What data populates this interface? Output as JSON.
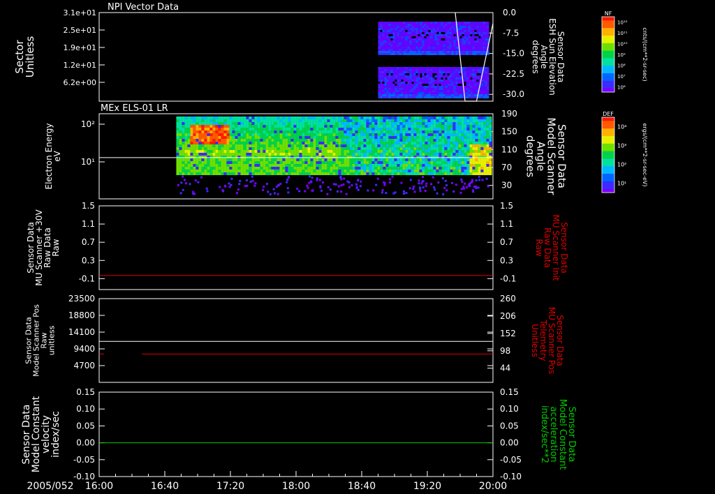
{
  "chart_data": [
    {
      "type": "heatmap",
      "title": "NPI Vector Data",
      "ylabel": [
        "Sector",
        "Unitless"
      ],
      "yticks": [
        "3.1e+01",
        "2.5e+01",
        "1.9e+01",
        "1.2e+01",
        "6.2e+00"
      ],
      "right_label": [
        "Sensor Data",
        "ESH Sun Elevation",
        "Angle",
        "degrees"
      ],
      "right_ticks": [
        "0.0",
        "-7.5",
        "-15.0",
        "-22.5",
        "-30.0"
      ],
      "right_range": [
        -32.5,
        0
      ],
      "colorbar": {
        "title": "NF",
        "unit": "cnts/(cm**2-sr-sec)",
        "ticks": [
          "10¹²",
          "10¹¹",
          "10¹⁰",
          "10⁹",
          "10⁸",
          "10⁷",
          "10⁶"
        ]
      },
      "data_start": "18:50",
      "overlay_line": {
        "times": [
          "19:37",
          "19:43",
          "19:50",
          "20:00"
        ],
        "values": [
          0,
          -32.5,
          -32.5,
          -4
        ]
      }
    },
    {
      "type": "heatmap",
      "title": "MEx ELS-01 LR",
      "ylabel": [
        "Electron Energy",
        "eV"
      ],
      "yticks": [
        "10²",
        "10¹"
      ],
      "right_label": [
        "Sensor Data",
        "Model Scanner",
        "Angle",
        "degrees"
      ],
      "right_ticks": [
        "190",
        "150",
        "110",
        "70",
        "30"
      ],
      "right_range": [
        0,
        190
      ],
      "colorbar": {
        "title": "DEF",
        "unit": "ergs/(cm**2-sr-sec-eV)",
        "ticks": [
          "10⁴",
          "10³",
          "10²",
          "10¹"
        ]
      },
      "data_start": "16:47",
      "overlay_value": 92
    },
    {
      "type": "line",
      "ylabel": [
        "Sensor Data",
        "MU Scanner +30V",
        "Raw Data",
        "Raw"
      ],
      "yticks": [
        "1.5",
        "1.1",
        "0.7",
        "0.3",
        "-0.1"
      ],
      "right_label": [
        "Sensor Data",
        "MU Scanner Init",
        "Raw Data",
        "Raw"
      ],
      "ylim": [
        -0.34,
        1.5
      ],
      "series": [
        {
          "color": "#e00000",
          "values": [
            -0.03
          ]
        }
      ]
    },
    {
      "type": "line",
      "ylabel": [
        "Sensor Data",
        "Model Scanner Pos",
        "Raw",
        "unitless"
      ],
      "yticks": [
        "23500",
        "18800",
        "14100",
        "9400",
        "4700"
      ],
      "right_label": [
        "Sensor Data",
        "MU Scanner Pos",
        "Telemetry",
        "Unitless"
      ],
      "right_ticks": [
        "260",
        "206",
        "152",
        "98",
        "44"
      ],
      "ylim": [
        0,
        23500
      ],
      "right_ylim": [
        0,
        260
      ],
      "series": [
        {
          "color": "#ffffff",
          "values": [
            11500
          ]
        },
        {
          "color": "#e00000",
          "segments": [
            [
              "16:00",
              "16:03"
            ],
            [
              "16:26",
              "20:00"
            ]
          ],
          "right_value": 88
        }
      ]
    },
    {
      "type": "line",
      "ylabel": [
        "Sensor Data",
        "Model Constant",
        "velocity",
        "index/sec"
      ],
      "yticks": [
        "0.15",
        "0.10",
        "0.05",
        "0.00",
        "-0.05",
        "-0.10"
      ],
      "right_label": [
        "Sensor Data",
        "Model Constant",
        "acceleration",
        "index/sec**2"
      ],
      "right_ticks": [
        "0.15",
        "0.10",
        "0.05",
        "0.00",
        "-0.05",
        "-0.10"
      ],
      "ylim": [
        -0.1,
        0.15
      ],
      "series": [
        {
          "color": "#00cc00",
          "values": [
            0.0
          ]
        }
      ]
    }
  ],
  "time_axis": {
    "date": "2005/052",
    "ticks": [
      "16:00",
      "16:40",
      "17:20",
      "18:00",
      "18:40",
      "19:20",
      "20:00"
    ],
    "start": "16:00",
    "end": "20:00"
  }
}
